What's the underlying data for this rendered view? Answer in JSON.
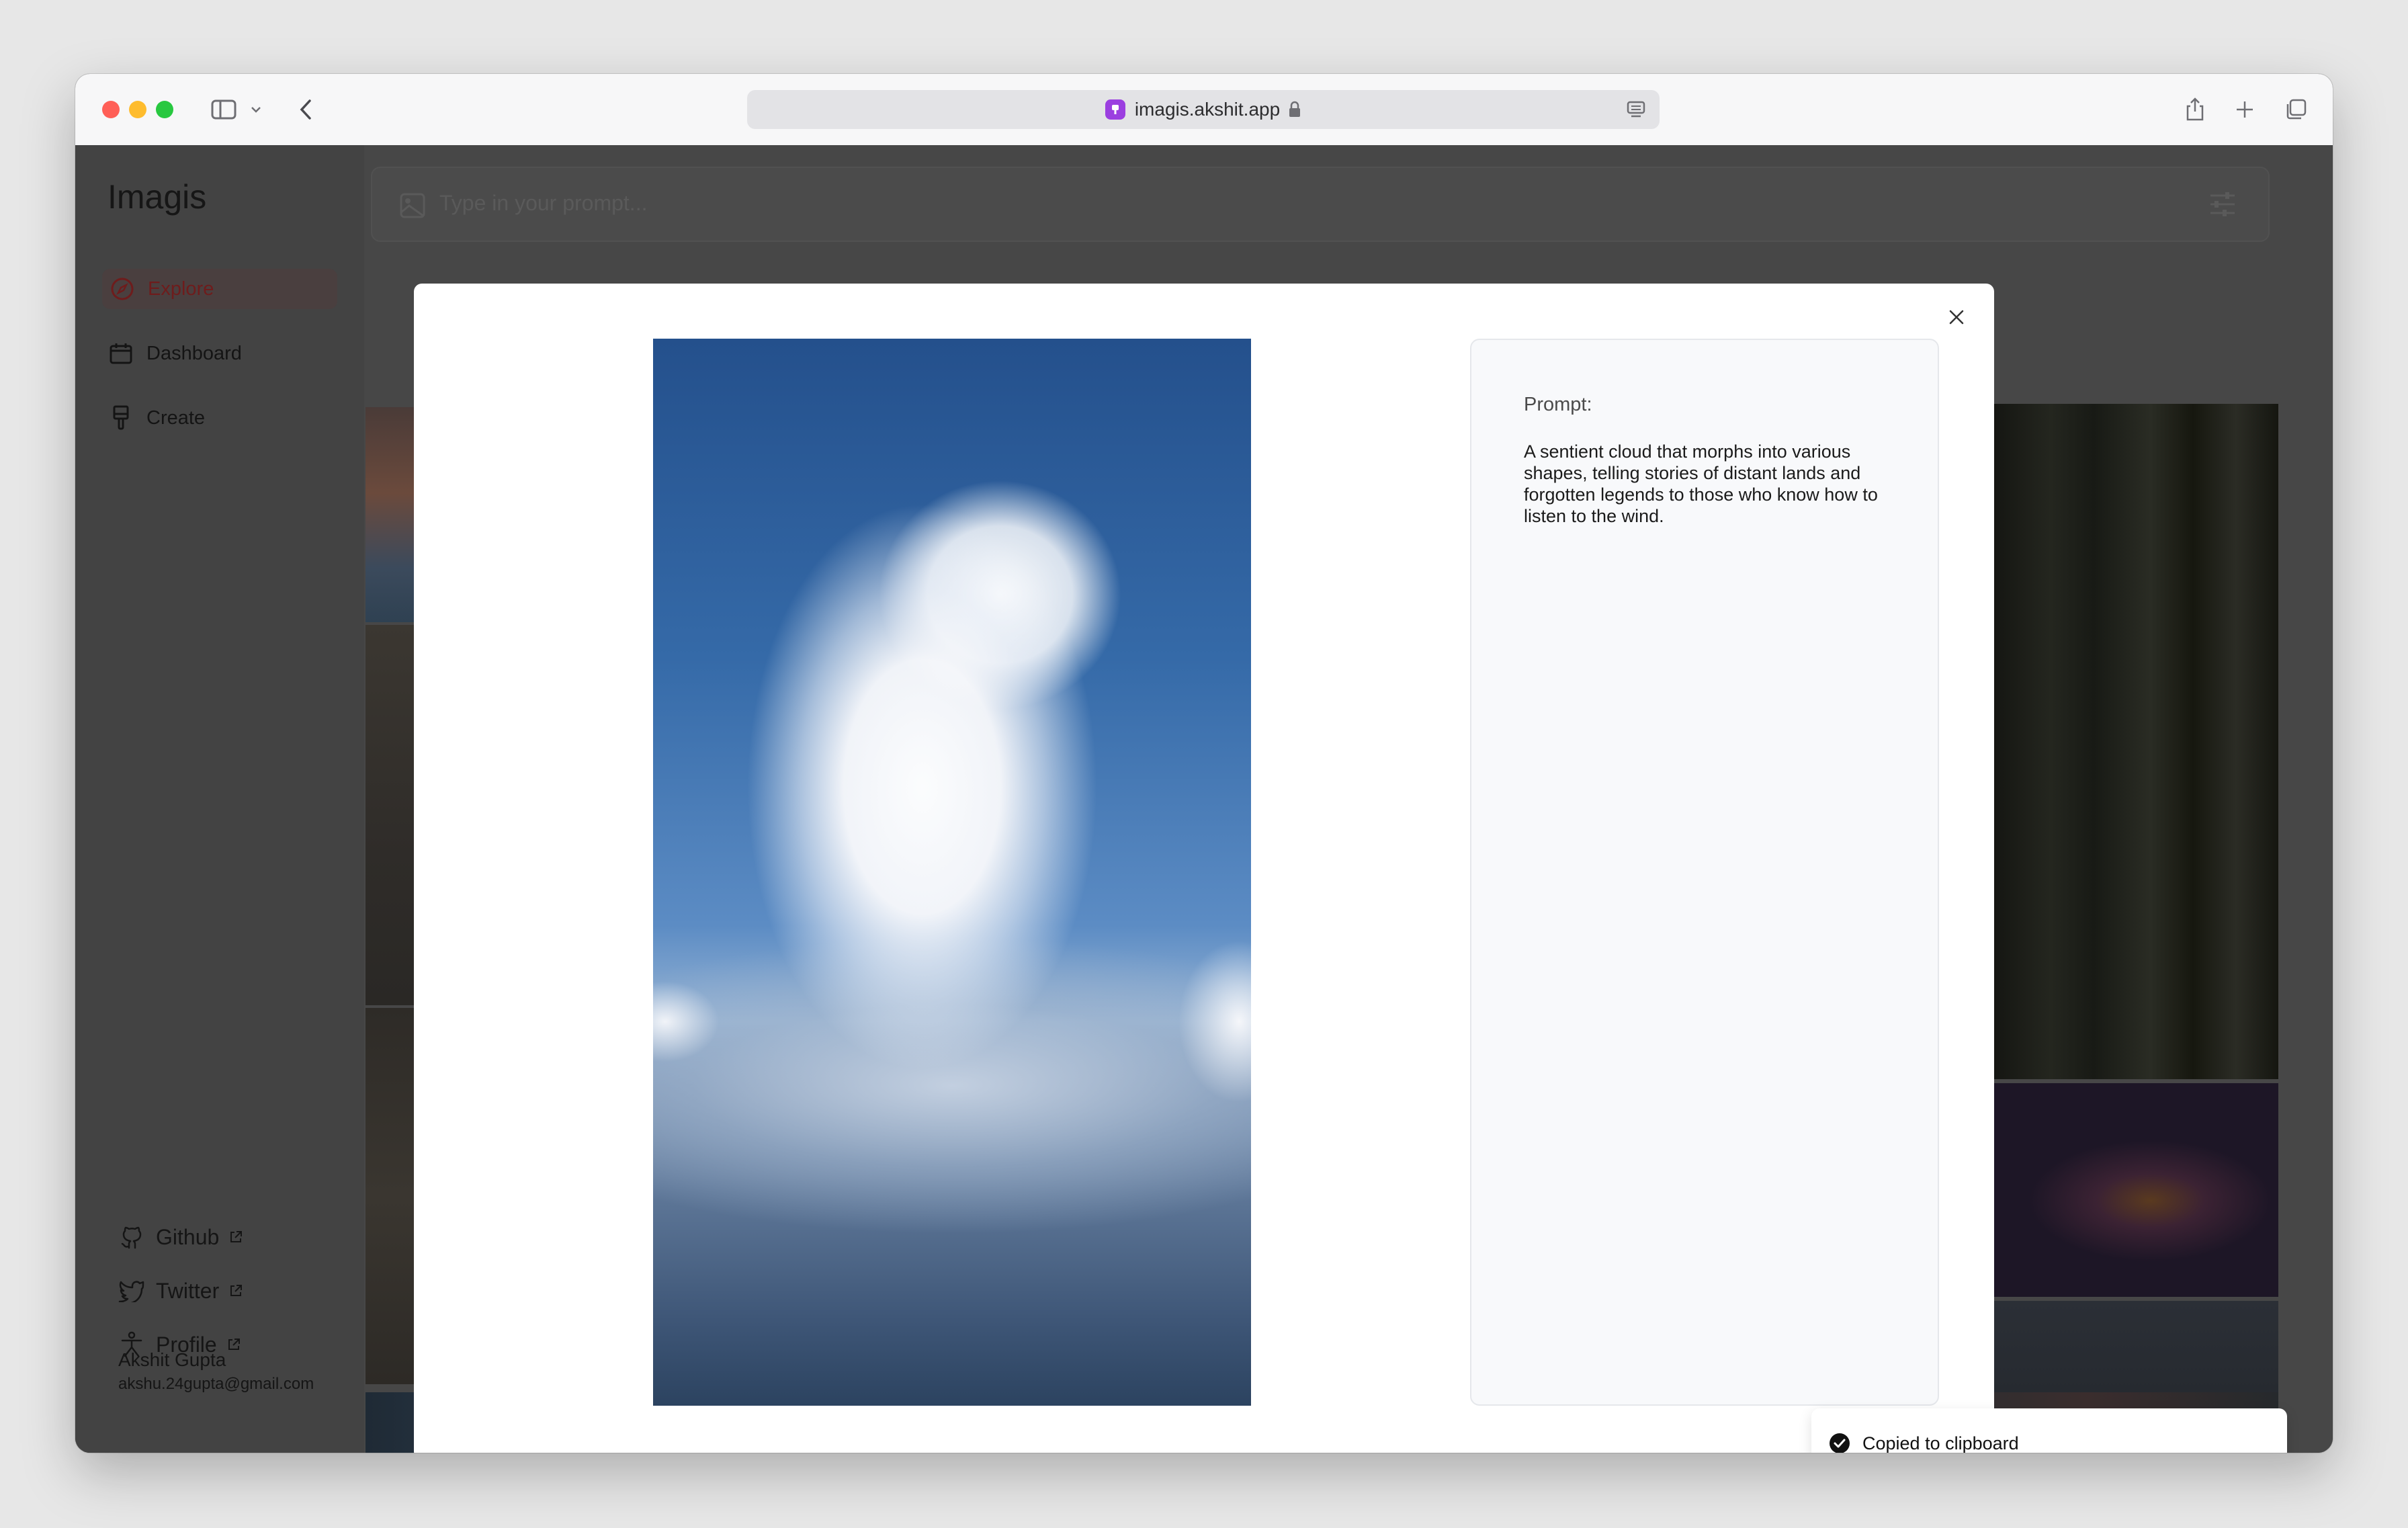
{
  "browser": {
    "url": "imagis.akshit.app"
  },
  "sidebar": {
    "logo": "Imagis",
    "nav": [
      {
        "label": "Explore",
        "active": true
      },
      {
        "label": "Dashboard",
        "active": false
      },
      {
        "label": "Create",
        "active": false
      }
    ],
    "links": [
      {
        "label": "Github"
      },
      {
        "label": "Twitter"
      },
      {
        "label": "Profile"
      }
    ],
    "user": {
      "name": "Akshit Gupta",
      "email": "akshu.24gupta@gmail.com"
    }
  },
  "prompt_bar": {
    "placeholder": "Type in your prompt..."
  },
  "modal": {
    "prompt_label": "Prompt:",
    "prompt_text": "A sentient cloud that morphs into various shapes, telling stories of distant lands and forgotten legends to those who know how to listen to the wind."
  },
  "toast": {
    "message": "Copied to clipboard"
  },
  "colors": {
    "accent": "#e11d48",
    "toast_check": "#111111"
  }
}
